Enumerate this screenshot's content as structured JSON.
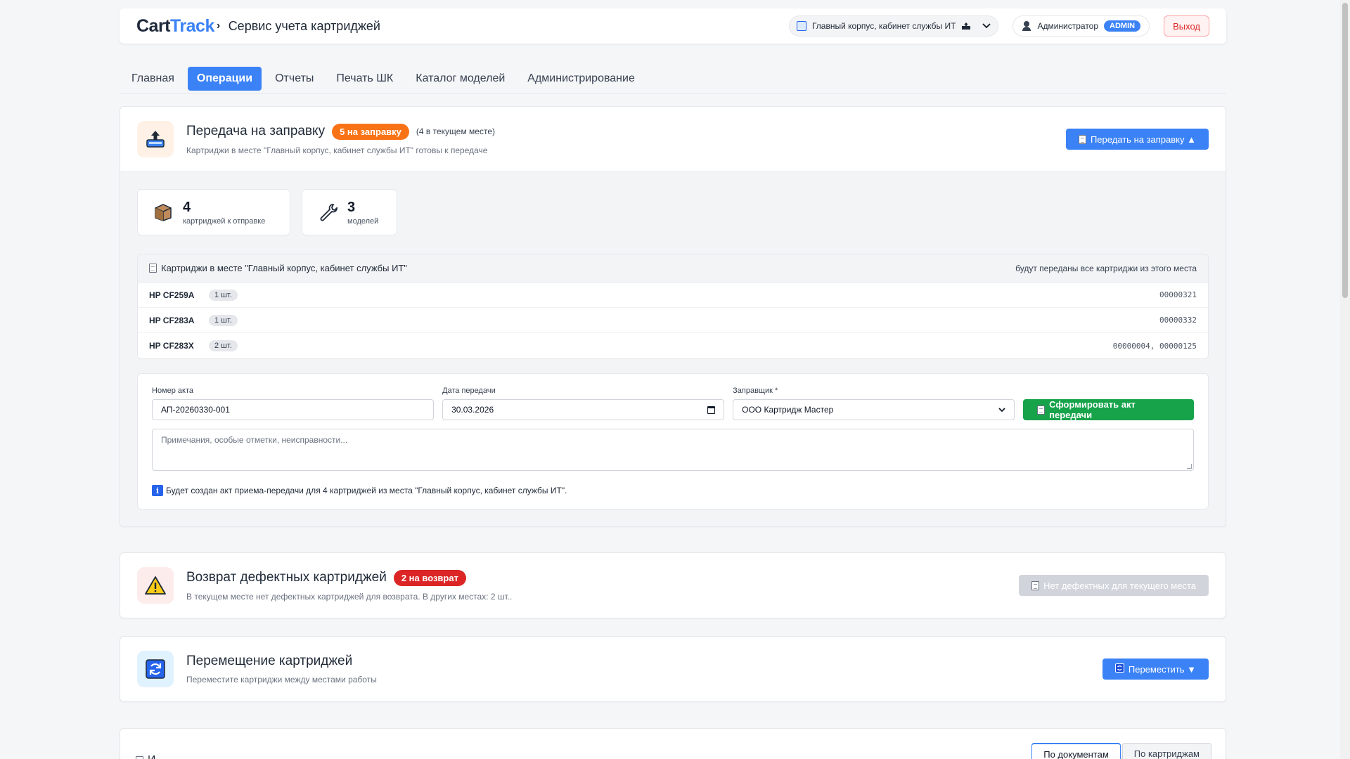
{
  "header": {
    "logo_cart": "Cart",
    "logo_track": "Track",
    "logo_caret": "›",
    "app_title": "Сервис учета картриджей",
    "location": "Главный корпус, кабинет службы ИТ",
    "user_name": "Администратор",
    "user_role": "ADMIN",
    "logout": "Выход"
  },
  "nav": {
    "items": [
      "Главная",
      "Операции",
      "Отчеты",
      "Печать ШК",
      "Каталог моделей",
      "Администрирование"
    ],
    "active_index": 1
  },
  "refill": {
    "title": "Передача на заправку",
    "badge": "5 на заправку",
    "note": "(4 в текущем месте)",
    "subtitle": "Картриджи в месте \"Главный корпус, кабинет службы ИТ\" готовы к передаче",
    "toggle_button": "Передать на заправку ▲",
    "stats": [
      {
        "value": "4",
        "label": "картриджей к отправке",
        "icon": "box-icon"
      },
      {
        "value": "3",
        "label": "моделей",
        "icon": "wrench-icon"
      }
    ],
    "list_title": "Картриджи в месте \"Главный корпус, кабинет службы ИТ\"",
    "list_note": "будут переданы все картриджи из этого места",
    "rows": [
      {
        "model": "HP CF259A",
        "qty": "1 шт.",
        "serials": "00000321"
      },
      {
        "model": "HP CF283A",
        "qty": "1 шт.",
        "serials": "00000332"
      },
      {
        "model": "HP CF283X",
        "qty": "2 шт.",
        "serials": "00000004, 00000125"
      }
    ],
    "form": {
      "act_label": "Номер акта",
      "act_value": "АП-20260330-001",
      "date_label": "Дата передачи",
      "date_value": "30.03.2026",
      "refiller_label": "Заправщик *",
      "refiller_value": "ООО Картридж Мастер",
      "submit": "Сформировать акт передачи",
      "notes_placeholder": "Примечания, особые отметки, неисправности...",
      "info_icon": "i",
      "info": "Будет создан акт приема-передачи для 4 картриджей из места \"Главный корпус, кабинет службы ИТ\"."
    }
  },
  "defect": {
    "title": "Возврат дефектных картриджей",
    "badge": "2 на возврат",
    "subtitle": "В текущем месте нет дефектных картриджей для возврата. В других местах: 2 шт..",
    "button": "Нет дефектных для текущего места"
  },
  "move": {
    "title": "Перемещение картриджей",
    "subtitle": "Переместите картриджи между местами работы",
    "button": "Переместить ▼"
  },
  "history": {
    "title_partial": "И",
    "tab_docs": "По документам",
    "tab_cartridges": "По картриджам"
  },
  "colors": {
    "accent": "#3b82f6",
    "orange": "#f97316",
    "red": "#dc2626",
    "green": "#16a34a"
  }
}
